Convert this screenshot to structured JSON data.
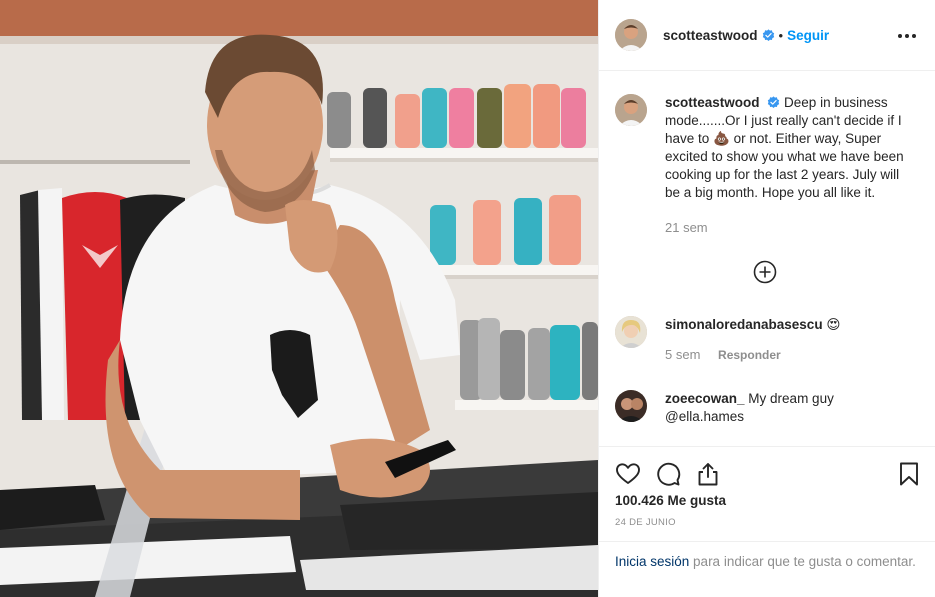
{
  "post": {
    "username": "scotteastwood",
    "separator": "•",
    "follow_label": "Seguir",
    "more_icon": "more-options-icon",
    "verified_icon": "verified-badge-icon"
  },
  "caption": {
    "username": "scotteastwood",
    "text_before": "Deep in business mode.......Or I just really can't decide if I have to ",
    "emoji": "💩",
    "text_after": " or not. Either way, Super excited to show you what we have been cooking up for the last 2 years. July will be a big month. Hope you all like it.",
    "time": "21 sem",
    "load_more_icon": "plus-circle-icon"
  },
  "comments": [
    {
      "username": "simonaloredanabasescu",
      "text": "😍",
      "time": "5 sem",
      "reply_label": "Responder"
    },
    {
      "username": "zoeecowan_",
      "text": "My dream guy @ella.hames"
    }
  ],
  "actions": {
    "like_icon": "heart-icon",
    "comment_icon": "comment-icon",
    "share_icon": "share-icon",
    "save_icon": "bookmark-icon",
    "likes": "100.426 Me gusta",
    "date": "24 DE JUNIO"
  },
  "login_prompt": {
    "link": "Inicia sesión",
    "rest": " para indicar que te gusta o comentar."
  },
  "colors": {
    "accent": "#0095f6",
    "text": "#262626",
    "muted": "#8e8e8e",
    "border": "#efefef",
    "link_dark": "#003569"
  }
}
